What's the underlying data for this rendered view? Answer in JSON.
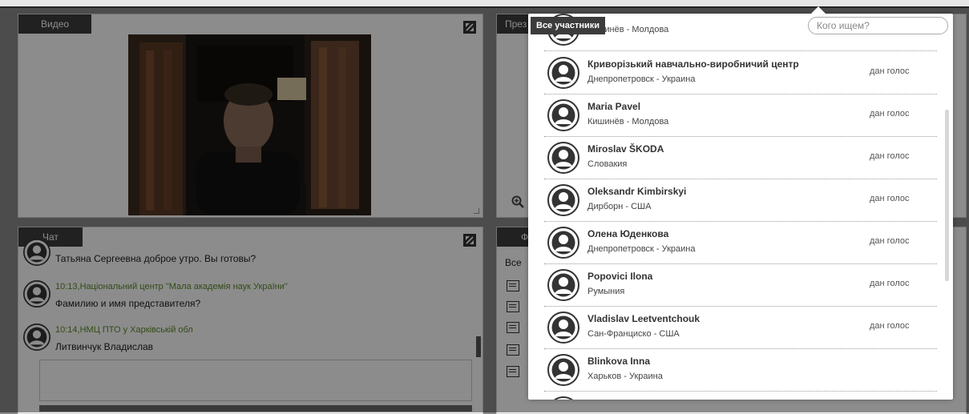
{
  "video_panel": {
    "label": "Видео"
  },
  "presentation_panel": {
    "label_partial": "През"
  },
  "chat_panel": {
    "label": "Чат",
    "messages": [
      {
        "meta": "",
        "text": "Татьяна Сергеевна доброе утро. Вы готовы?"
      },
      {
        "meta": "10:13,Національний центр \"Мала академія наук України\"",
        "text": "Фамилию и имя представителя?"
      },
      {
        "meta": "10:14,НМЦ ПТО у Харківській обл",
        "text": "Литвинчук Владислав"
      }
    ]
  },
  "files_panel": {
    "label_partial": "Ф",
    "filter_partial": "Все"
  },
  "participants_popup": {
    "tab_label": "Все участники",
    "search_placeholder": "Кого ищем?",
    "participants": [
      {
        "name": "",
        "location": "Кишинёв - Молдова",
        "status": ""
      },
      {
        "name": "Криворізький навчально-виробничий центр",
        "location": "Днепропетровск - Украина",
        "status": "дан голос"
      },
      {
        "name": "Maria Pavel",
        "location": "Кишинёв - Молдова",
        "status": "дан голос"
      },
      {
        "name": "Miroslav ŠKODA",
        "location": "Словакия",
        "status": "дан голос"
      },
      {
        "name": "Oleksandr Kimbirskyi",
        "location": "Дирборн - США",
        "status": "дан голос"
      },
      {
        "name": "Олена Юденкова",
        "location": "Днепропетровск - Украина",
        "status": "дан голос"
      },
      {
        "name": "Popovici Ilona",
        "location": "Румыния",
        "status": "дан голос"
      },
      {
        "name": "Vladislav Leetventchouk",
        "location": "Сан-Франциско - США",
        "status": "дан голос"
      },
      {
        "name": "Blinkova Inna",
        "location": "Харьков - Украина",
        "status": ""
      },
      {
        "name": "",
        "location": "",
        "status": ""
      }
    ]
  },
  "icons": {
    "expand": "expand-icon",
    "zoom": "zoom-in-icon",
    "avatar": "user-avatar-icon",
    "file": "file-icon"
  },
  "colors": {
    "panel_tab": "#3c3c3c",
    "chat_meta": "#5a8a2a",
    "overlay": "rgba(0,0,0,0.45)"
  }
}
